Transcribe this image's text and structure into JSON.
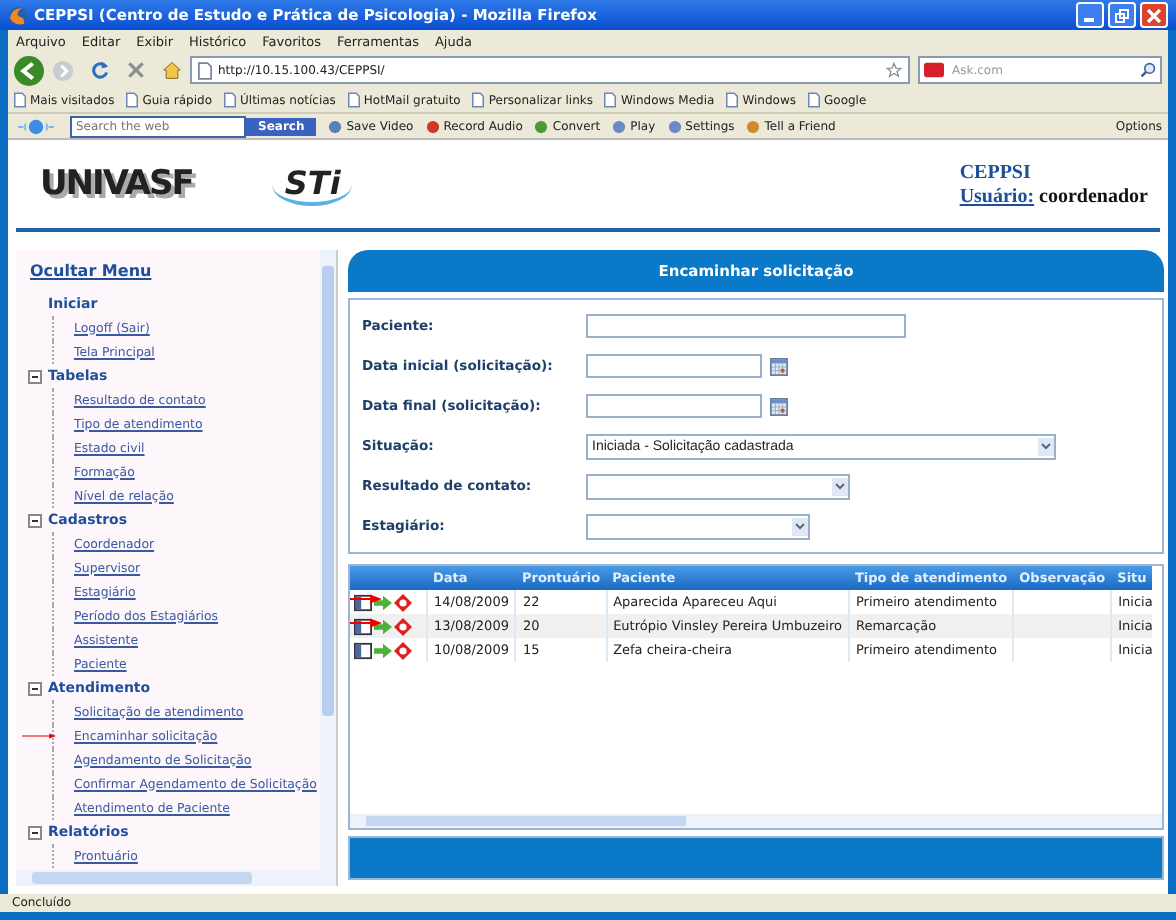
{
  "window": {
    "title": "CEPPSI (Centro de Estudo e Prática de Psicologia) - Mozilla Firefox"
  },
  "menu": [
    "Arquivo",
    "Editar",
    "Exibir",
    "Histórico",
    "Favoritos",
    "Ferramentas",
    "Ajuda"
  ],
  "address": "http://10.15.100.43/CEPPSI/",
  "web_search": {
    "placeholder": "Ask.com"
  },
  "bookmarks": [
    "Mais visitados",
    "Guia rápido",
    "Últimas notícias",
    "HotMail gratuito",
    "Personalizar links",
    "Windows Media",
    "Windows",
    "Google"
  ],
  "ask_toolbar": {
    "placeholder": "Search the web",
    "search_button": "Search",
    "items": [
      "Save Video",
      "Record Audio",
      "Convert",
      "Play",
      "Settings",
      "Tell a Friend"
    ],
    "options": "Options"
  },
  "header": {
    "logos": [
      "UNIVASF",
      "STi"
    ],
    "app": "CEPPSI",
    "user_label": "Usuário:",
    "user": "coordenador"
  },
  "sidebar": {
    "toggle": "Ocultar Menu",
    "groups": [
      {
        "title": "Iniciar",
        "collapsible": false,
        "children": [
          {
            "label": "Logoff (Sair)",
            "pointer": false
          },
          {
            "label": "Tela Principal",
            "pointer": false
          }
        ]
      },
      {
        "title": "Tabelas",
        "collapsible": true,
        "children": [
          {
            "label": "Resultado de contato",
            "pointer": false
          },
          {
            "label": "Tipo de atendimento",
            "pointer": false
          },
          {
            "label": "Estado civil",
            "pointer": false
          },
          {
            "label": "Formação",
            "pointer": false
          },
          {
            "label": "Nível de relação",
            "pointer": false
          }
        ]
      },
      {
        "title": "Cadastros",
        "collapsible": true,
        "children": [
          {
            "label": "Coordenador",
            "pointer": false
          },
          {
            "label": "Supervisor",
            "pointer": false
          },
          {
            "label": "Estagiário",
            "pointer": false
          },
          {
            "label": "Período dos Estagiários",
            "pointer": false
          },
          {
            "label": "Assistente",
            "pointer": false
          },
          {
            "label": "Paciente",
            "pointer": false
          }
        ]
      },
      {
        "title": "Atendimento",
        "collapsible": true,
        "children": [
          {
            "label": "Solicitação de atendimento",
            "pointer": false
          },
          {
            "label": "Encaminhar solicitação",
            "pointer": true
          },
          {
            "label": "Agendamento de Solicitação",
            "pointer": false
          },
          {
            "label": "Confirmar Agendamento de Solicitação",
            "pointer": false
          },
          {
            "label": "Atendimento de Paciente",
            "pointer": false
          }
        ]
      },
      {
        "title": "Relatórios",
        "collapsible": true,
        "children": [
          {
            "label": "Prontuário",
            "pointer": false
          }
        ]
      }
    ]
  },
  "form": {
    "title": "Encaminhar solicitação",
    "fields": [
      {
        "label": "Paciente:",
        "kind": "text"
      },
      {
        "label": "Data inicial (solicitação):",
        "kind": "date"
      },
      {
        "label": "Data final (solicitação):",
        "kind": "date"
      },
      {
        "label": "Situação:",
        "kind": "select",
        "value": "Iniciada - Solicitação cadastrada"
      },
      {
        "label": "Resultado de contato:",
        "kind": "select"
      },
      {
        "label": "Estagiário:",
        "kind": "select"
      }
    ]
  },
  "results": {
    "columns": [
      "Data",
      "Prontuário",
      "Paciente",
      "Tipo de atendimento",
      "Observação",
      "Situ"
    ],
    "rows": [
      {
        "date": "14/08/2009",
        "record": "22",
        "patient": "Aparecida Apareceu Aqui",
        "type": "Primeiro atendimento",
        "status": "Inicia",
        "pointer": true
      },
      {
        "date": "13/08/2009",
        "record": "20",
        "patient": "Eutrópio Vinsley Pereira Umbuzeiro",
        "type": "Remarcação",
        "status": "Inicia",
        "pointer": true
      },
      {
        "date": "10/08/2009",
        "record": "15",
        "patient": "Zefa cheira-cheira",
        "type": "Primeiro atendimento",
        "status": "Inicia",
        "pointer": false
      }
    ]
  },
  "status_bar": "Concluído"
}
